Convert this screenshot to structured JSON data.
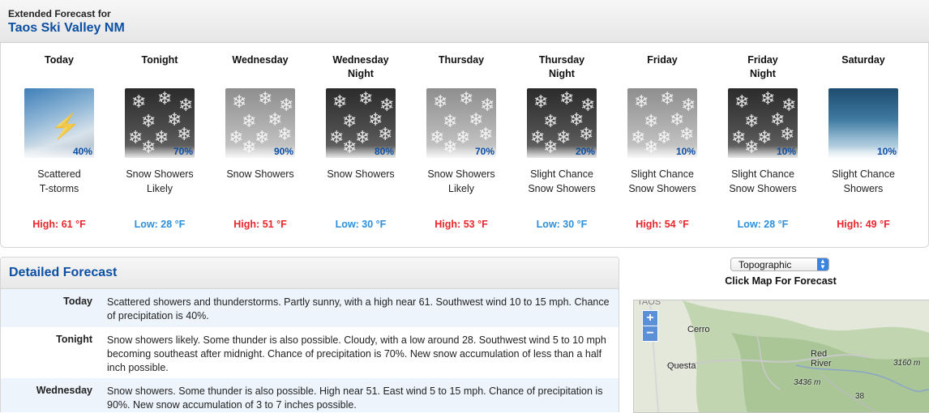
{
  "header": {
    "subtitle": "Extended Forecast for",
    "location": "Taos Ski Valley NM"
  },
  "periods": [
    {
      "name": "Today",
      "icon": "thunderstorm-icon",
      "pop": "40%",
      "desc": "Scattered\nT-storms",
      "temp": "High: 61 °F",
      "type": "high"
    },
    {
      "name": "Tonight",
      "icon": "snow-night-icon",
      "pop": "70%",
      "desc": "Snow Showers\nLikely",
      "temp": "Low: 28 °F",
      "type": "low"
    },
    {
      "name": "Wednesday",
      "icon": "snow-icon",
      "pop": "90%",
      "desc": "Snow Showers",
      "temp": "High: 51 °F",
      "type": "high"
    },
    {
      "name": "Wednesday\nNight",
      "icon": "snow-night-icon",
      "pop": "80%",
      "desc": "Snow Showers",
      "temp": "Low: 30 °F",
      "type": "low"
    },
    {
      "name": "Thursday",
      "icon": "snow-icon",
      "pop": "70%",
      "desc": "Snow Showers\nLikely",
      "temp": "High: 53 °F",
      "type": "high"
    },
    {
      "name": "Thursday\nNight",
      "icon": "snow-night-icon",
      "pop": "20%",
      "desc": "Slight Chance\nSnow Showers",
      "temp": "Low: 30 °F",
      "type": "low"
    },
    {
      "name": "Friday",
      "icon": "snow-icon",
      "pop": "10%",
      "desc": "Slight Chance\nSnow Showers",
      "temp": "High: 54 °F",
      "type": "high"
    },
    {
      "name": "Friday\nNight",
      "icon": "snow-night-icon",
      "pop": "10%",
      "desc": "Slight Chance\nSnow Showers",
      "temp": "Low: 28 °F",
      "type": "low"
    },
    {
      "name": "Saturday",
      "icon": "showers-icon",
      "pop": "10%",
      "desc": "Slight Chance\nShowers",
      "temp": "High: 49 °F",
      "type": "high"
    }
  ],
  "detailed": {
    "title": "Detailed Forecast",
    "rows": [
      {
        "label": "Today",
        "text": "Scattered showers and thunderstorms. Partly sunny, with a high near 61. Southwest wind 10 to 15 mph. Chance of precipitation is 40%."
      },
      {
        "label": "Tonight",
        "text": "Snow showers likely. Some thunder is also possible. Cloudy, with a low around 28. Southwest wind 5 to 10 mph becoming southeast after midnight. Chance of precipitation is 70%. New snow accumulation of less than a half inch possible."
      },
      {
        "label": "Wednesday",
        "text": "Snow showers. Some thunder is also possible. High near 51. East wind 5 to 15 mph. Chance of precipitation is 90%. New snow accumulation of 3 to 7 inches possible."
      }
    ]
  },
  "map": {
    "type_select": "Topographic",
    "hint": "Click Map For Forecast",
    "zoom_in": "+",
    "zoom_out": "−",
    "labels": {
      "taos": "TAOS",
      "cerro": "Cerro",
      "questa": "Questa",
      "red_river": "Red\nRiver",
      "elev1": "3436 m",
      "elev2": "3160 m",
      "road": "38"
    }
  },
  "colors": {
    "high": "#e8262b",
    "low": "#2b8fd9",
    "accent": "#0b4fa3"
  }
}
